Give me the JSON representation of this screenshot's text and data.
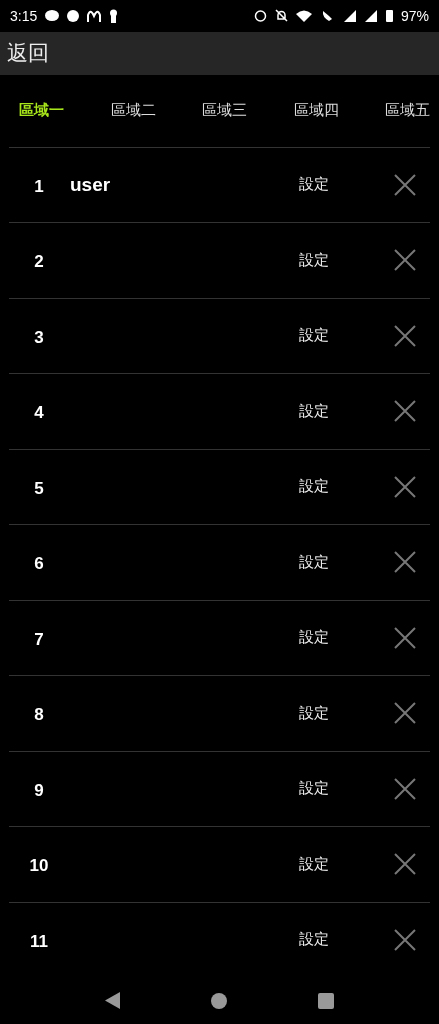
{
  "status_bar": {
    "time": "3:15",
    "battery": "97%"
  },
  "app_bar": {
    "back": "返回"
  },
  "tabs": [
    {
      "label": "區域一",
      "selected": true
    },
    {
      "label": "區域二",
      "selected": false
    },
    {
      "label": "區域三",
      "selected": false
    },
    {
      "label": "區域四",
      "selected": false
    },
    {
      "label": "區域五",
      "selected": false
    }
  ],
  "rows": [
    {
      "number": "1",
      "name": "user",
      "action": "設定"
    },
    {
      "number": "2",
      "action": "設定"
    },
    {
      "number": "3",
      "action": "設定"
    },
    {
      "number": "4",
      "action": "設定"
    },
    {
      "number": "5",
      "action": "設定"
    },
    {
      "number": "6",
      "action": "設定"
    },
    {
      "number": "7",
      "action": "設定"
    },
    {
      "number": "8",
      "action": "設定"
    },
    {
      "number": "9",
      "action": "設定"
    },
    {
      "number": "10",
      "action": "設定"
    },
    {
      "number": "11",
      "action": "設定"
    }
  ]
}
